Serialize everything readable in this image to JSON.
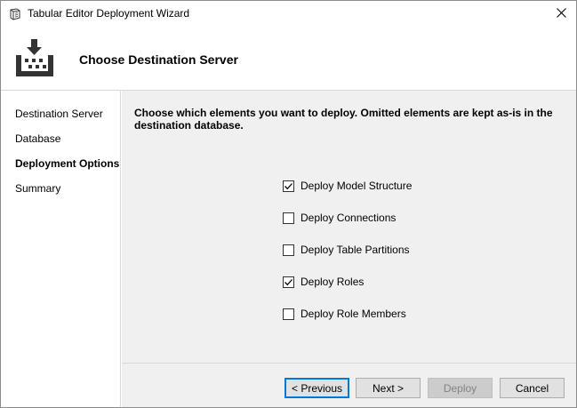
{
  "window": {
    "title": "Tabular Editor Deployment Wizard"
  },
  "header": {
    "title": "Choose Destination Server"
  },
  "sidebar": {
    "items": [
      {
        "label": "Destination Server",
        "active": false
      },
      {
        "label": "Database",
        "active": false
      },
      {
        "label": "Deployment Options",
        "active": true
      },
      {
        "label": "Summary",
        "active": false
      }
    ]
  },
  "main": {
    "instructions": "Choose which elements you want to deploy. Omitted elements are kept as-is in the destination database.",
    "options": [
      {
        "label": "Deploy Model Structure",
        "checked": true
      },
      {
        "label": "Deploy Connections",
        "checked": false
      },
      {
        "label": "Deploy Table Partitions",
        "checked": false
      },
      {
        "label": "Deploy Roles",
        "checked": true
      },
      {
        "label": "Deploy Role Members",
        "checked": false
      }
    ]
  },
  "footer": {
    "previous_label": "< Previous",
    "next_label": "Next >",
    "deploy_label": "Deploy",
    "cancel_label": "Cancel"
  },
  "colors": {
    "accent": "#0078d7",
    "panel_bg": "#f0f0f0",
    "button_bg": "#e1e1e1",
    "disabled_bg": "#cccccc",
    "disabled_text": "#838383"
  },
  "icons": {
    "app": "tabular-editor-icon",
    "header": "deploy-icon",
    "close": "close-icon",
    "check": "checkmark-icon"
  }
}
